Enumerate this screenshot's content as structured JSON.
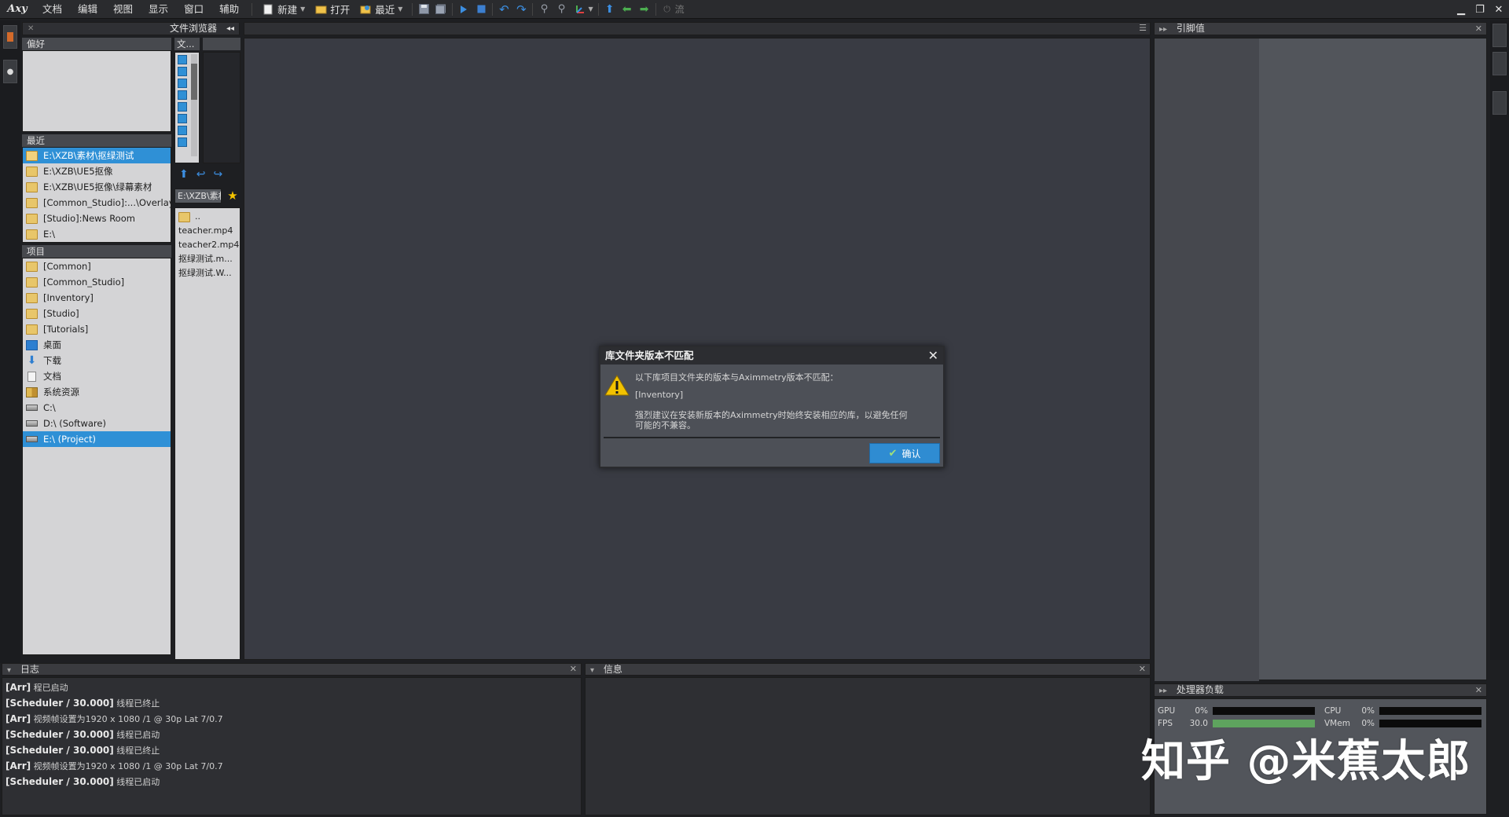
{
  "app": {
    "logo": "Axy"
  },
  "menu": [
    "文档",
    "编辑",
    "视图",
    "显示",
    "窗口",
    "辅助"
  ],
  "toolbar": {
    "new_label": "新建",
    "open_label": "打开",
    "recent_label": "最近",
    "flow_label": "流"
  },
  "file_browser": {
    "title": "文件浏览器",
    "favorites_header": "偏好",
    "recent_header": "最近",
    "recent": [
      "E:\\XZB\\素材\\抠绿测试",
      "E:\\XZB\\UE5抠像",
      "E:\\XZB\\UE5抠像\\绿幕素材",
      "[Common_Studio]:...\\Overlays",
      "[Studio]:News Room",
      "E:\\"
    ],
    "projects_header": "项目",
    "projects": [
      {
        "label": "[Common]",
        "icon": "folder"
      },
      {
        "label": "[Common_Studio]",
        "icon": "folder"
      },
      {
        "label": "[Inventory]",
        "icon": "folder"
      },
      {
        "label": "[Studio]",
        "icon": "folder"
      },
      {
        "label": "[Tutorials]",
        "icon": "folder"
      },
      {
        "label": "桌面",
        "icon": "desktop"
      },
      {
        "label": "下载",
        "icon": "download"
      },
      {
        "label": "文档",
        "icon": "document"
      },
      {
        "label": "系统资源",
        "icon": "system"
      },
      {
        "label": "C:\\",
        "icon": "drive"
      },
      {
        "label": "D:\\ (Software)",
        "icon": "drive"
      },
      {
        "label": "E:\\ (Project)",
        "icon": "drive"
      }
    ],
    "tree_header": "文...",
    "path_value": "E:\\XZB\\素材\\抠绿测试",
    "files": [
      "..",
      "teacher.mp4",
      "teacher2.mp4",
      "抠绿测试.m...",
      "抠绿测试.W..."
    ]
  },
  "right_panel": {
    "title": "引脚值"
  },
  "cpu_panel": {
    "title": "处理器负载",
    "meters": [
      {
        "label": "GPU",
        "value": "0%",
        "fill": 0
      },
      {
        "label": "CPU",
        "value": "0%",
        "fill": 0
      },
      {
        "label": "FPS",
        "value": "30.0",
        "fill": 1.0
      },
      {
        "label": "VMem",
        "value": "0%",
        "fill": 0
      }
    ]
  },
  "log_panel": {
    "title": "日志",
    "lines": [
      {
        "src": "[Arr]",
        "msg": " 程已启动"
      },
      {
        "src": "[Scheduler / 30.000]",
        "msg": " 线程已终止"
      },
      {
        "src": "[Arr]",
        "msg": " 视频帧设置为1920 x 1080 /1 @ 30p  Lat 7/0.7"
      },
      {
        "src": "[Scheduler / 30.000]",
        "msg": " 线程已启动"
      },
      {
        "src": "[Scheduler / 30.000]",
        "msg": " 线程已终止"
      },
      {
        "src": "[Arr]",
        "msg": " 视频帧设置为1920 x 1080 /1 @ 30p  Lat 7/0.7"
      },
      {
        "src": "[Scheduler / 30.000]",
        "msg": " 线程已启动"
      }
    ]
  },
  "info_panel": {
    "title": "信息"
  },
  "dialog": {
    "title": "库文件夹版本不匹配",
    "line1": "以下库项目文件夹的版本与Aximmetry版本不匹配：",
    "item": "[Inventory]",
    "line3a": "强烈建议在安装新版本的Aximmetry时始终安装相应的库，以避免任何",
    "line3b": "可能的不兼容。",
    "ok_label": "确认"
  },
  "watermark": "知乎 @米蕉太郎"
}
